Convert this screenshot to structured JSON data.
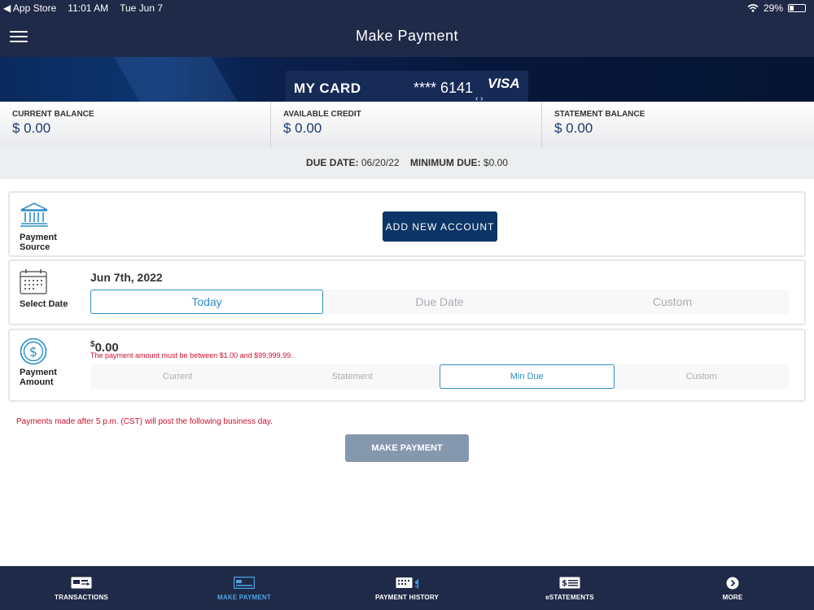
{
  "status_bar": {
    "carrier": "◀ App Store",
    "time": "11:01 AM",
    "date": "Tue Jun 7",
    "battery": "29%"
  },
  "header": {
    "title": "Make Payment"
  },
  "card": {
    "name": "MY CARD",
    "masked_number": "**** 6141",
    "brand": "VISA",
    "arrows": "‹ ›"
  },
  "balances": [
    {
      "label": "CURRENT BALANCE",
      "value": "$ 0.00"
    },
    {
      "label": "AVAILABLE CREDIT",
      "value": "$ 0.00"
    },
    {
      "label": "STATEMENT BALANCE",
      "value": "$ 0.00"
    }
  ],
  "due": {
    "due_date_label": "DUE DATE:",
    "due_date": "06/20/22",
    "min_due_label": "MINIMUM DUE:",
    "min_due": "$0.00"
  },
  "payment_source": {
    "label_line1": "Payment",
    "label_line2": "Source",
    "add_button": "ADD NEW ACCOUNT"
  },
  "select_date": {
    "label": "Select Date",
    "value": "Jun 7th, 2022",
    "options": [
      "Today",
      "Due Date",
      "Custom"
    ],
    "selected": "Today"
  },
  "payment_amount": {
    "label_line1": "Payment",
    "label_line2": "Amount",
    "currency": "$",
    "value": "0.00",
    "error": "The payment amount must be between $1.00 and $99,999.99.",
    "options": [
      "Current",
      "Statement",
      "Min Due",
      "Custom"
    ],
    "selected": "Min Due"
  },
  "notice": "Payments made after 5 p.m. (CST) will post the following business day.",
  "make_payment_button": "MAKE PAYMENT",
  "bottom_nav": [
    {
      "label": "TRANSACTIONS",
      "icon": "transactions-icon"
    },
    {
      "label": "MAKE PAYMENT",
      "icon": "make-payment-icon",
      "active": true
    },
    {
      "label": "PAYMENT HISTORY",
      "icon": "payment-history-icon"
    },
    {
      "label": "eSTATEMENTS",
      "icon": "estatements-icon"
    },
    {
      "label": "MORE",
      "icon": "more-icon"
    }
  ],
  "colors": {
    "navy": "#1f2a48",
    "accent": "#2c8ec9",
    "error": "#c8102e",
    "button_dark": "#0c3466",
    "button_disabled": "#8698ae"
  }
}
